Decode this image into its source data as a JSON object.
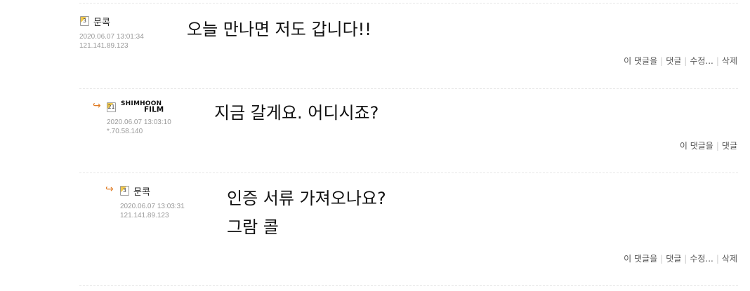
{
  "comments": [
    {
      "level": "3",
      "nickname": "문콕",
      "datetime": "2020.06.07 13:01:34",
      "ip": "121.141.89.123",
      "lines": [
        "오늘 만나면 저도 갑니다!!"
      ],
      "actions": {
        "reply_this": "이 댓글을",
        "reply": "댓글",
        "edit": "수정...",
        "delete": "삭제"
      }
    },
    {
      "level": "21",
      "nickname_logo": "SHIMHOON FILM",
      "datetime": "2020.06.07 13:03:10",
      "ip": "*.70.58.140",
      "lines": [
        "지금 갈게요. 어디시죠?"
      ],
      "actions": {
        "reply_this": "이 댓글을",
        "reply": "댓글"
      }
    },
    {
      "level": "3",
      "nickname": "문콕",
      "datetime": "2020.06.07 13:03:31",
      "ip": "121.141.89.123",
      "lines": [
        "인증 서류 가져오나요?",
        "그람 콜"
      ],
      "actions": {
        "reply_this": "이 댓글을",
        "reply": "댓글",
        "edit": "수정...",
        "delete": "삭제"
      }
    }
  ],
  "icons": {
    "reply_arrow": "reply-arrow-icon",
    "arrow_color": "#e07a22"
  }
}
